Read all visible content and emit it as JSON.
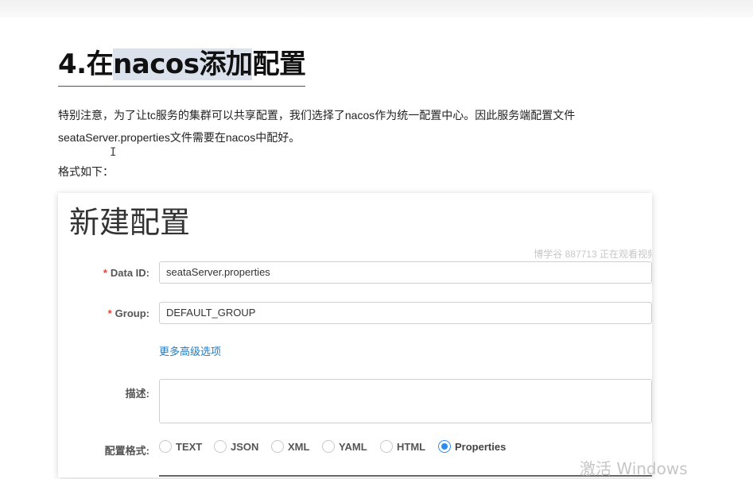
{
  "heading": {
    "prefix": "4.在",
    "highlight": "nacos添加",
    "suffix": "配置"
  },
  "paragraph1": "特别注意，为了让tc服务的集群可以共享配置，我们选择了nacos作为统一配置中心。因此服务端配置文件seataServer.properties文件需要在nacos中配好。",
  "paragraph2": "格式如下：",
  "text_cursor": "I",
  "form": {
    "title": "新建配置",
    "watermark": "博学谷 887713 正在观看视频",
    "required_mark": "*",
    "data_id_label": "Data ID:",
    "data_id_value": "seataServer.properties",
    "group_label": "Group:",
    "group_value": "DEFAULT_GROUP",
    "advanced_link": "更多高级选项",
    "desc_label": "描述:",
    "format_label": "配置格式:",
    "formats": [
      "TEXT",
      "JSON",
      "XML",
      "YAML",
      "HTML",
      "Properties"
    ],
    "selected_format": "Properties"
  },
  "activate_watermark": "激活 Windows",
  "colors": {
    "required": "#e5442d",
    "link": "#1d7cc5",
    "radio_checked": "#2d8cf0",
    "heading_highlight": "#dbe2ec"
  }
}
